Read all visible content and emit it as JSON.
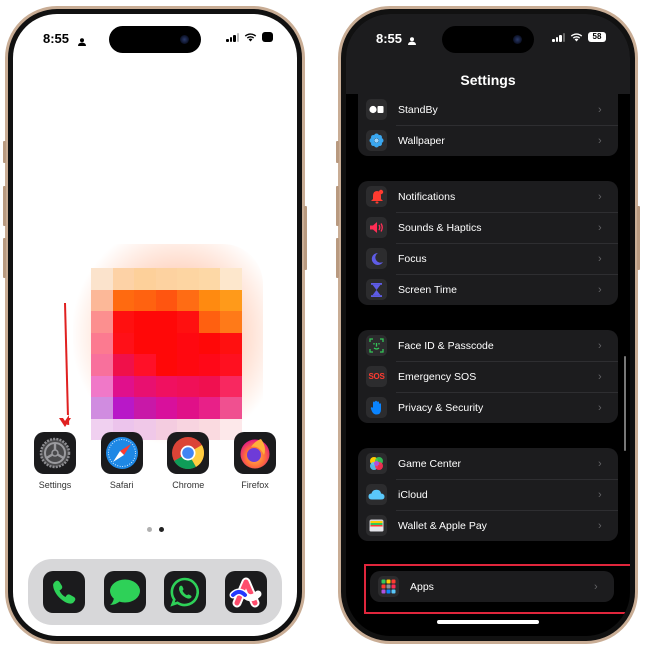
{
  "home_screen": {
    "status_bar": {
      "time": "8:55",
      "person_icon": "person-icon",
      "battery_label": ""
    },
    "apps": [
      {
        "label": "Settings",
        "icon": "settings-gear-icon"
      },
      {
        "label": "Safari",
        "icon": "safari-compass-icon"
      },
      {
        "label": "Chrome",
        "icon": "chrome-icon"
      },
      {
        "label": "Firefox",
        "icon": "firefox-icon"
      }
    ],
    "page_dots": {
      "count": 2,
      "active_index": 1
    },
    "dock": [
      {
        "name": "Phone",
        "icon": "phone-icon"
      },
      {
        "name": "Messages",
        "icon": "messages-icon"
      },
      {
        "name": "WhatsApp",
        "icon": "whatsapp-icon"
      },
      {
        "name": "Arc",
        "icon": "arc-browser-icon"
      }
    ],
    "annotation": {
      "type": "arrow",
      "color": "#e02020",
      "points_to": "Settings"
    }
  },
  "settings_screen": {
    "status_bar": {
      "time": "8:55",
      "battery_label": "58"
    },
    "title": "Settings",
    "groups": [
      {
        "items": [
          {
            "label": "StandBy",
            "icon": "standby-icon",
            "color": "#ffffff"
          },
          {
            "label": "Wallpaper",
            "icon": "wallpaper-flower-icon",
            "color": "#3aa7f0"
          }
        ]
      },
      {
        "items": [
          {
            "label": "Notifications",
            "icon": "notifications-bell-icon",
            "color": "#ff3b30"
          },
          {
            "label": "Sounds & Haptics",
            "icon": "speaker-icon",
            "color": "#ff2d55"
          },
          {
            "label": "Focus",
            "icon": "moon-icon",
            "color": "#5e5ce6"
          },
          {
            "label": "Screen Time",
            "icon": "hourglass-icon",
            "color": "#5e5ce6"
          }
        ]
      },
      {
        "items": [
          {
            "label": "Face ID & Passcode",
            "icon": "face-id-icon",
            "color": "#34c759"
          },
          {
            "label": "Emergency SOS",
            "icon": "sos-icon",
            "color": "#ff3b30",
            "glyph": "SOS"
          },
          {
            "label": "Privacy & Security",
            "icon": "hand-icon",
            "color": "#0a84ff"
          }
        ]
      },
      {
        "items": [
          {
            "label": "Game Center",
            "icon": "game-center-icon",
            "color": "#ff9f0a"
          },
          {
            "label": "iCloud",
            "icon": "cloud-icon",
            "color": "#5ac8fa"
          },
          {
            "label": "Wallet & Apple Pay",
            "icon": "wallet-icon",
            "color": "#d1d1d6"
          }
        ]
      }
    ],
    "highlighted_item": {
      "label": "Apps",
      "icon": "apps-grid-icon"
    },
    "highlight_color": "#e0263c",
    "chevron": "›"
  }
}
